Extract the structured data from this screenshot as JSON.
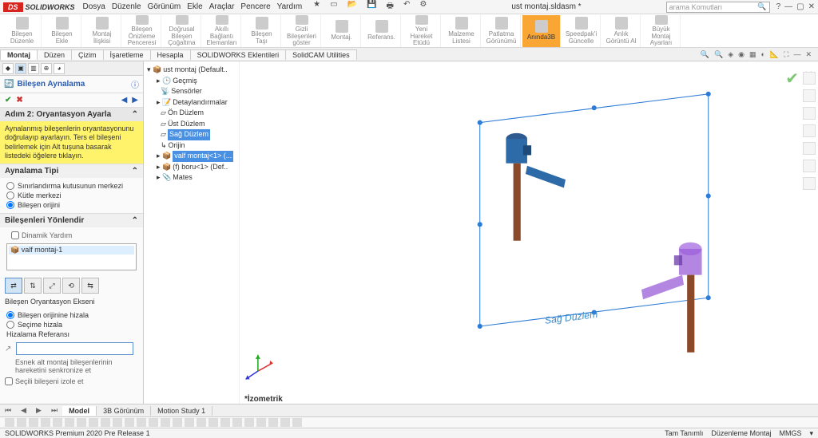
{
  "app": {
    "brand_short": "DS",
    "brand": "SOLIDWORKS",
    "doc_title": "ust montaj.sldasm *"
  },
  "menu": [
    "Dosya",
    "Düzenle",
    "Görünüm",
    "Ekle",
    "Araçlar",
    "Pencere",
    "Yardım"
  ],
  "search_placeholder": "arama Komutları",
  "ribbon": [
    {
      "label": "Bileşen\nDüzenle"
    },
    {
      "label": "Bileşen Ekle"
    },
    {
      "label": "Montaj\nİlişkisi"
    },
    {
      "label": "Bileşen Önizleme\nPenceresi"
    },
    {
      "label": "Doğrusal Bileşen Çoğaltma"
    },
    {
      "label": "Akıllı Bağlantı\nElemanları"
    },
    {
      "label": "Bileşen Taşı"
    },
    {
      "label": "Gizli Bileşenleri\ngöster"
    },
    {
      "label": "Montaj."
    },
    {
      "label": "Referans."
    },
    {
      "label": "Yeni Hareket\nEtüdü"
    },
    {
      "label": "Malzeme\nListesi"
    },
    {
      "label": "Patlatma Görünümü"
    },
    {
      "label": "Anında3B",
      "active": true
    },
    {
      "label": "Speedpak'i\nGüncelle"
    },
    {
      "label": "Anlık\nGörüntü Al"
    },
    {
      "label": "Büyük Montaj\nAyarları"
    }
  ],
  "tabs": [
    "Montaj",
    "Düzen",
    "Çizim",
    "İşaretleme",
    "Hesapla",
    "SOLIDWORKS Eklentileri",
    "SolidCAM Utilities"
  ],
  "pm": {
    "title": "Bileşen Aynalama",
    "step": "Adım 2: Oryantasyon Ayarla",
    "hint": "Aynalanmış bileşenlerin oryantasyonunu doğrulayıp ayarlayın. Ters el bileşeni belirlemek için Alt tuşuna basarak listedeki öğelere tıklayın.",
    "section_type": "Aynalama Tipi",
    "radio_type": [
      "Sınırlandırma kutusunun merkezi",
      "Kütle merkezi",
      "Bileşen orijini"
    ],
    "radio_type_sel": 2,
    "section_orient": "Bileşenleri Yönlendir",
    "dyn_help": "Dinamik Yardım",
    "list_item": "valf montaj-1",
    "axis_label": "Bileşen Oryantasyon Ekseni",
    "radio_axis": [
      "Bileşen orijinine hizala",
      "Seçime hizala"
    ],
    "radio_axis_sel": 0,
    "ref_label": "Hizalama Referansı",
    "sync_label": "Esnek alt montaj bileşenlerinin hareketini senkronize et",
    "isolate": "Seçili bileşeni izole et"
  },
  "tree": {
    "root": "ust montaj  (Default..",
    "nodes": [
      "Geçmiş",
      "Sensörler",
      "Detaylandırmalar",
      "Ön Düzlem",
      "Üst Düzlem",
      "Sağ Düzlem",
      "Orijin",
      "valf montaj<1> (...",
      "(f) boru<1> (Def..",
      "Mates"
    ]
  },
  "viewport": {
    "plane_label": "Sağ Düzlem",
    "iso": "İzometrik"
  },
  "bottom_tabs": [
    "Model",
    "3B Görünüm",
    "Motion Study 1"
  ],
  "status": {
    "left": "SOLIDWORKS Premium 2020 Pre Release 1",
    "right": [
      "Tam Tanımlı",
      "Düzenleme Montaj",
      "MMGS"
    ]
  }
}
